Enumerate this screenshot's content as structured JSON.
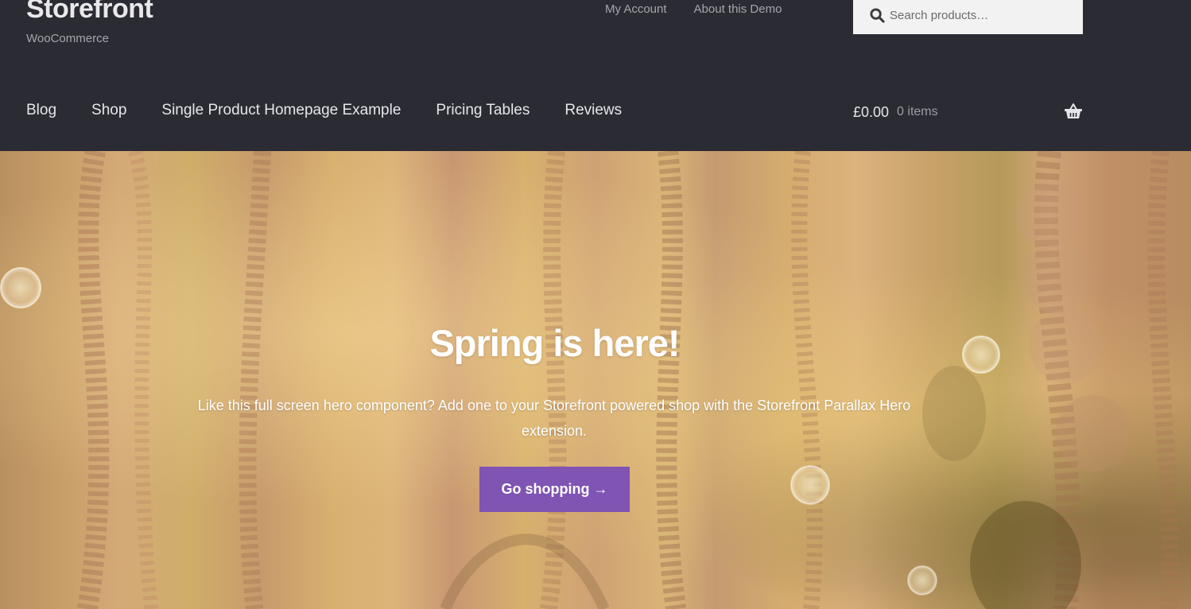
{
  "site": {
    "title": "Storefront",
    "tagline": "WooCommerce"
  },
  "secondary_nav": {
    "items": [
      {
        "label": "My Account"
      },
      {
        "label": "About this Demo"
      }
    ]
  },
  "search": {
    "placeholder": "Search products…",
    "value": "",
    "icon": "search-icon"
  },
  "primary_nav": {
    "items": [
      {
        "label": "Blog"
      },
      {
        "label": "Shop"
      },
      {
        "label": "Single Product Homepage Example"
      },
      {
        "label": "Pricing Tables"
      },
      {
        "label": "Reviews"
      }
    ]
  },
  "cart": {
    "amount": "£0.00",
    "count": "0 items",
    "icon": "basket-icon"
  },
  "hero": {
    "title": "Spring is here!",
    "text": "Like this full screen hero component? Add one to your Storefront powered shop with the Storefront Parallax Hero extension.",
    "button_label": "Go shopping →"
  },
  "colors": {
    "header_bg": "#2b2c33",
    "button_bg": "#7f54b3",
    "search_bg": "#f2f2f2"
  }
}
